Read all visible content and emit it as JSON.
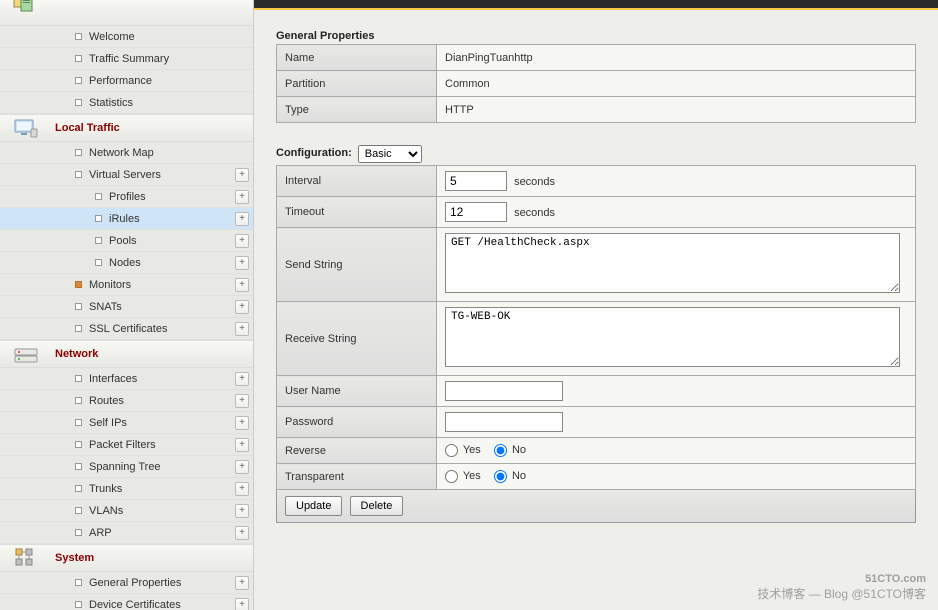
{
  "sidebar": {
    "overview_items": [
      "Welcome",
      "Traffic Summary",
      "Performance",
      "Statistics"
    ],
    "local_traffic_header": "Local Traffic",
    "local_traffic_items": [
      {
        "label": "Network Map",
        "plus": false,
        "indent": false,
        "sel": false
      },
      {
        "label": "Virtual Servers",
        "plus": true,
        "indent": false,
        "sel": false
      },
      {
        "label": "Profiles",
        "plus": true,
        "indent": true,
        "sel": false
      },
      {
        "label": "iRules",
        "plus": true,
        "indent": true,
        "sel": true
      },
      {
        "label": "Pools",
        "plus": true,
        "indent": true,
        "sel": false
      },
      {
        "label": "Nodes",
        "plus": true,
        "indent": true,
        "sel": false
      },
      {
        "label": "Monitors",
        "plus": true,
        "indent": false,
        "sel": false,
        "orange": true
      },
      {
        "label": "SNATs",
        "plus": true,
        "indent": false,
        "sel": false
      },
      {
        "label": "SSL Certificates",
        "plus": true,
        "indent": false,
        "sel": false
      }
    ],
    "network_header": "Network",
    "network_items": [
      "Interfaces",
      "Routes",
      "Self IPs",
      "Packet Filters",
      "Spanning Tree",
      "Trunks",
      "VLANs",
      "ARP"
    ],
    "system_header": "System",
    "system_items": [
      "General Properties",
      "Device Certificates"
    ]
  },
  "general_properties": {
    "title": "General Properties",
    "rows": [
      {
        "label": "Name",
        "value": "DianPingTuanhttp"
      },
      {
        "label": "Partition",
        "value": "Common"
      },
      {
        "label": "Type",
        "value": "HTTP"
      }
    ]
  },
  "configuration": {
    "label": "Configuration:",
    "dropdown": "Basic",
    "interval_label": "Interval",
    "interval_value": "5",
    "timeout_label": "Timeout",
    "timeout_value": "12",
    "seconds": "seconds",
    "send_string_label": "Send String",
    "send_string_value": "GET /HealthCheck.aspx",
    "receive_string_label": "Receive String",
    "receive_string_value": "TG-WEB-OK",
    "user_name_label": "User Name",
    "user_name_value": "",
    "password_label": "Password",
    "password_value": "",
    "reverse_label": "Reverse",
    "transparent_label": "Transparent",
    "yes": "Yes",
    "no": "No"
  },
  "buttons": {
    "update": "Update",
    "delete": "Delete"
  },
  "watermark": {
    "main": "51CTO.com",
    "sub": "技术博客 — Blog\n@51CTO博客"
  }
}
